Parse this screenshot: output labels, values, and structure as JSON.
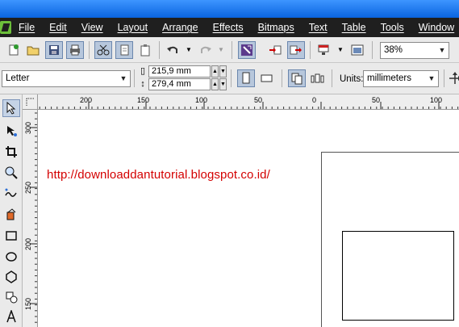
{
  "menu": [
    "File",
    "Edit",
    "View",
    "Layout",
    "Arrange",
    "Effects",
    "Bitmaps",
    "Text",
    "Table",
    "Tools",
    "Window"
  ],
  "toolbar": {
    "zoom_value": "38%"
  },
  "property_bar": {
    "page_size": "Letter",
    "width": "215,9 mm",
    "height": "279,4 mm",
    "units_label": "Units:",
    "units_value": "millimeters"
  },
  "ruler_h": [
    "200",
    "150",
    "100",
    "50",
    "0",
    "50",
    "100"
  ],
  "ruler_v": [
    "300",
    "250",
    "200",
    "150"
  ],
  "canvas": {
    "url_text": "http://downloaddantutorial.blogspot.co.id/"
  },
  "colors": {
    "title_bar": "#0a64e0",
    "menu_bg": "#1f1f1f",
    "url_text": "#d40000"
  }
}
